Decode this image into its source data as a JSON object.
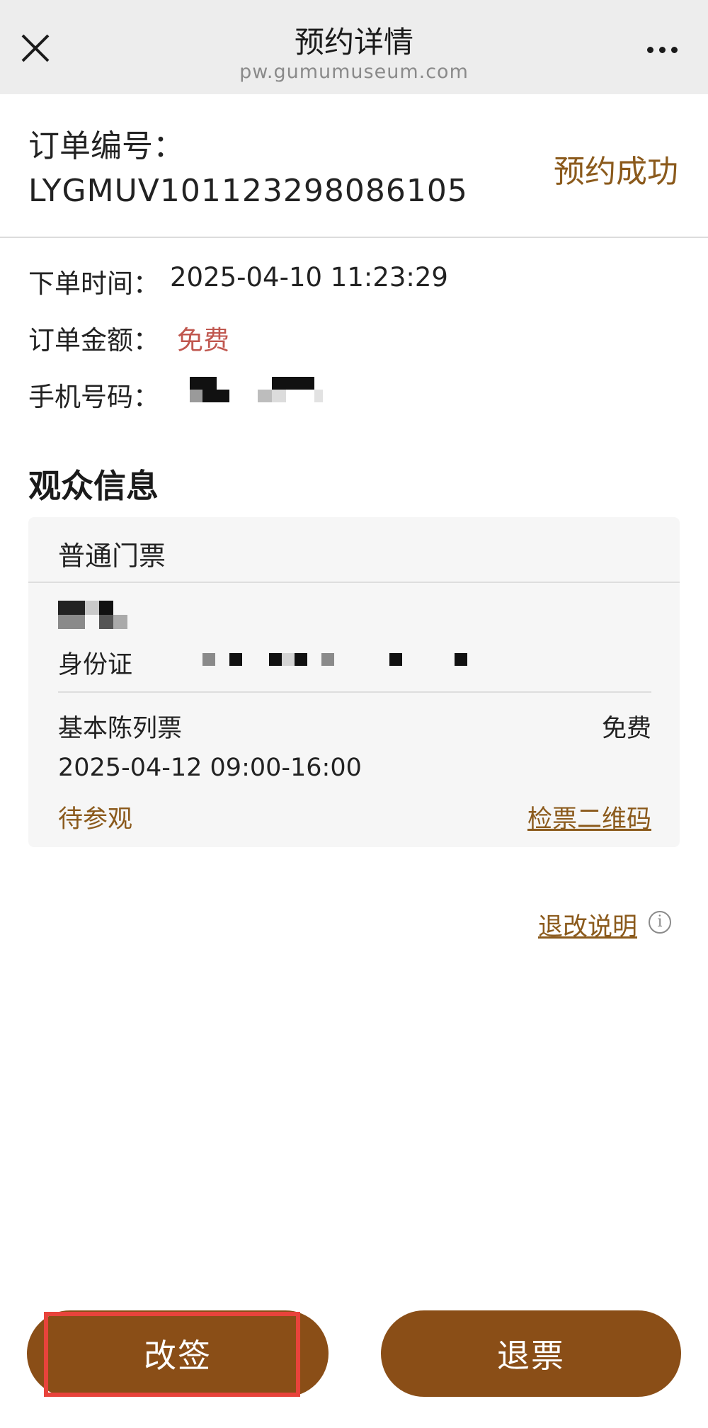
{
  "header": {
    "title": "预约详情",
    "domain": "pw.gumumuseum.com",
    "close_icon": "close-icon",
    "more_icon": "more-horizontal-icon"
  },
  "order": {
    "number_label": "订单编号：",
    "number": "LYGMUV101123298086105",
    "status": "预约成功",
    "order_time_label": "下单时间：",
    "order_time": "2025-04-10 11:23:29",
    "amount_label": "订单金额：",
    "amount": "免费",
    "phone_label": "手机号码："
  },
  "audience": {
    "section_title": "观众信息",
    "ticket_category": "普通门票",
    "id_label": "身份证",
    "ticket_type": "基本陈列票",
    "ticket_price": "免费",
    "visit_time": "2025-04-12 09:00-16:00",
    "visit_status": "待参观",
    "qr_link": "检票二维码"
  },
  "footer": {
    "refund_note": "退改说明",
    "info_icon": "info-icon",
    "info_glyph": "i",
    "reschedule_label": "改签",
    "refund_label": "退票"
  },
  "colors": {
    "accent": "#8b5a1c",
    "button": "#8a4e17",
    "free_red": "#c0574f",
    "highlight": "#e8433b"
  }
}
